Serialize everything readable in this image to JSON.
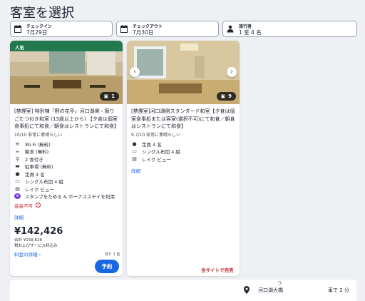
{
  "page": {
    "title": "客室を選択"
  },
  "search": {
    "checkin_label": "チェックイン",
    "checkin_value": "7月29日",
    "checkout_label": "チェックアウト",
    "checkout_value": "7月30日",
    "guests_label": "旅行者",
    "guests_value": "1 室 4 名"
  },
  "rooms": [
    {
      "badge": "人気",
      "photo_count": "1",
      "name": "[禁煙室] 特別棟「野の花亭」河口湖側・掘りごたつ付き和室 (13歳以上から) 【夕食は個室食事処にて和食／朝食はレストランにて和食】",
      "rating": "10/10 非常に素晴らしい",
      "amenities": [
        "Wi-Fi (無料)",
        "朝食 (無料)",
        "2 食付き",
        "駐車場 (無料)",
        "定員 4 名",
        "シングル布団 4 組",
        "レイク ビュー",
        "スタンプをためる & ボーナスステイを利用"
      ],
      "refund": "返金不可",
      "details_link": "詳細",
      "price": "¥142,426",
      "total": "合計 ¥158,626",
      "tax_note": "税およびサービス料込み",
      "price_details_link": "料金の詳細",
      "rooms_left": "残り 1 室",
      "reserve_label": "予約"
    },
    {
      "photo_count": "9",
      "name": "[禁煙室]河口湖側スタンダード和室【夕食は個室食事処または客室(選択不可)にて和食／朝食はレストランにて和食】",
      "rating": "9.7/10 非常に素晴らしい",
      "amenities": [
        "定員 4 名",
        "シングル布団 4 組",
        "レイク ビュー"
      ],
      "details_link": "詳細",
      "soldout": "当サイトで完売"
    }
  ],
  "location": {
    "name": "河口湖大橋",
    "partial": "つ",
    "distance": "車で 2 分"
  }
}
